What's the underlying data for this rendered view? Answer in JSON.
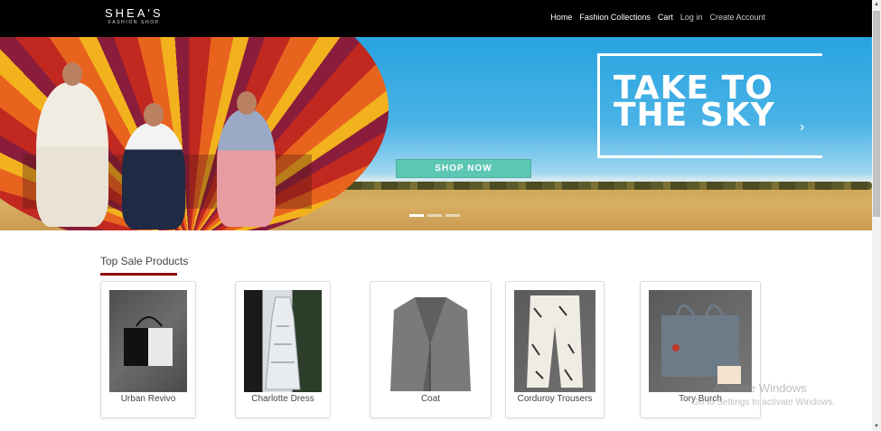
{
  "nav": {
    "logo_main": "SHEA'S",
    "logo_sub": "FASHION SHOP",
    "items": [
      {
        "label": "Home"
      },
      {
        "label": "Fashion Collections"
      },
      {
        "label": "Cart"
      },
      {
        "label": "Log in"
      },
      {
        "label": "Create Account"
      }
    ]
  },
  "hero": {
    "headline_line1": "TAKE TO",
    "headline_line2": "THE SKY",
    "button_label": "SHOP NOW",
    "next_arrow": "›",
    "slides": 3,
    "active_slide": 1
  },
  "section": {
    "title": "Top Sale Products",
    "accent_color": "#8b0000"
  },
  "products": [
    {
      "name": "Urban Revivo"
    },
    {
      "name": "Charlotte Dress"
    },
    {
      "name": "Coat"
    },
    {
      "name": "Corduroy Trousers"
    },
    {
      "name": "Tory Burch"
    }
  ],
  "watermark": {
    "line1": "Activate Windows",
    "line2": "Go to Settings to activate Windows."
  }
}
